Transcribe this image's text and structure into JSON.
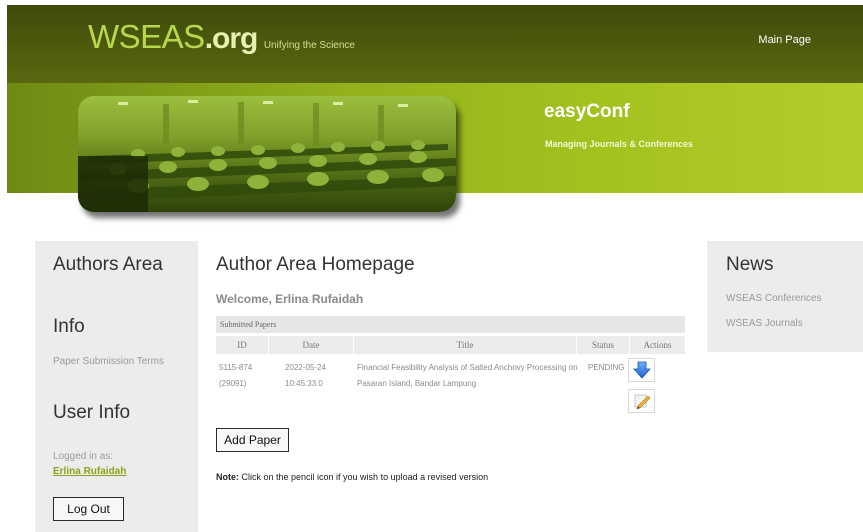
{
  "header": {
    "brand_main": "WSEAS",
    "brand_org": ".org",
    "tagline": "Unifying the Science",
    "main_page": "Main Page"
  },
  "banner": {
    "title": "easyConf",
    "subtitle": "Managing Journals & Conferences"
  },
  "left_sidebar": {
    "authors_area": "Authors Area",
    "info_heading": "Info",
    "paper_terms": "Paper Submission Terms",
    "user_info_heading": "User Info",
    "logged_in_label": "Logged in as:",
    "user_name": "Erlina Rufaidah",
    "logout": "Log Out"
  },
  "right_sidebar": {
    "news_heading": "News",
    "links": [
      "WSEAS Conferences",
      "WSEAS Journals"
    ]
  },
  "main": {
    "title": "Author Area Homepage",
    "welcome": "Welcome, Erlina Rufaidah",
    "table": {
      "caption": "Submitted Papers",
      "headers": [
        "ID",
        "Date",
        "Title",
        "Status",
        "Actions"
      ],
      "rows": [
        {
          "id_line1": "5115-874",
          "id_line2": "(29091)",
          "date_line1": "2022-05-24",
          "date_line2": "10:45:33.0",
          "title_line1": "Financial Feasibility Analysis of Salted Anchovy Processing on",
          "title_line2": "Pasaran Island, Bandar Lampung",
          "status": "PENDING",
          "actions": [
            "download-arrow-icon",
            "pencil-edit-icon"
          ]
        }
      ]
    },
    "add_paper": "Add Paper",
    "note_label": "Note:",
    "note_text": " Click on the pencil icon if you wish to upload a revised version"
  },
  "colors": {
    "header_dark": "#4e5b0d",
    "banner_green": "#a4c21e",
    "brand_green": "#b7d84a",
    "link_green": "#8aa31c",
    "sidebar_gray": "#ececec"
  }
}
